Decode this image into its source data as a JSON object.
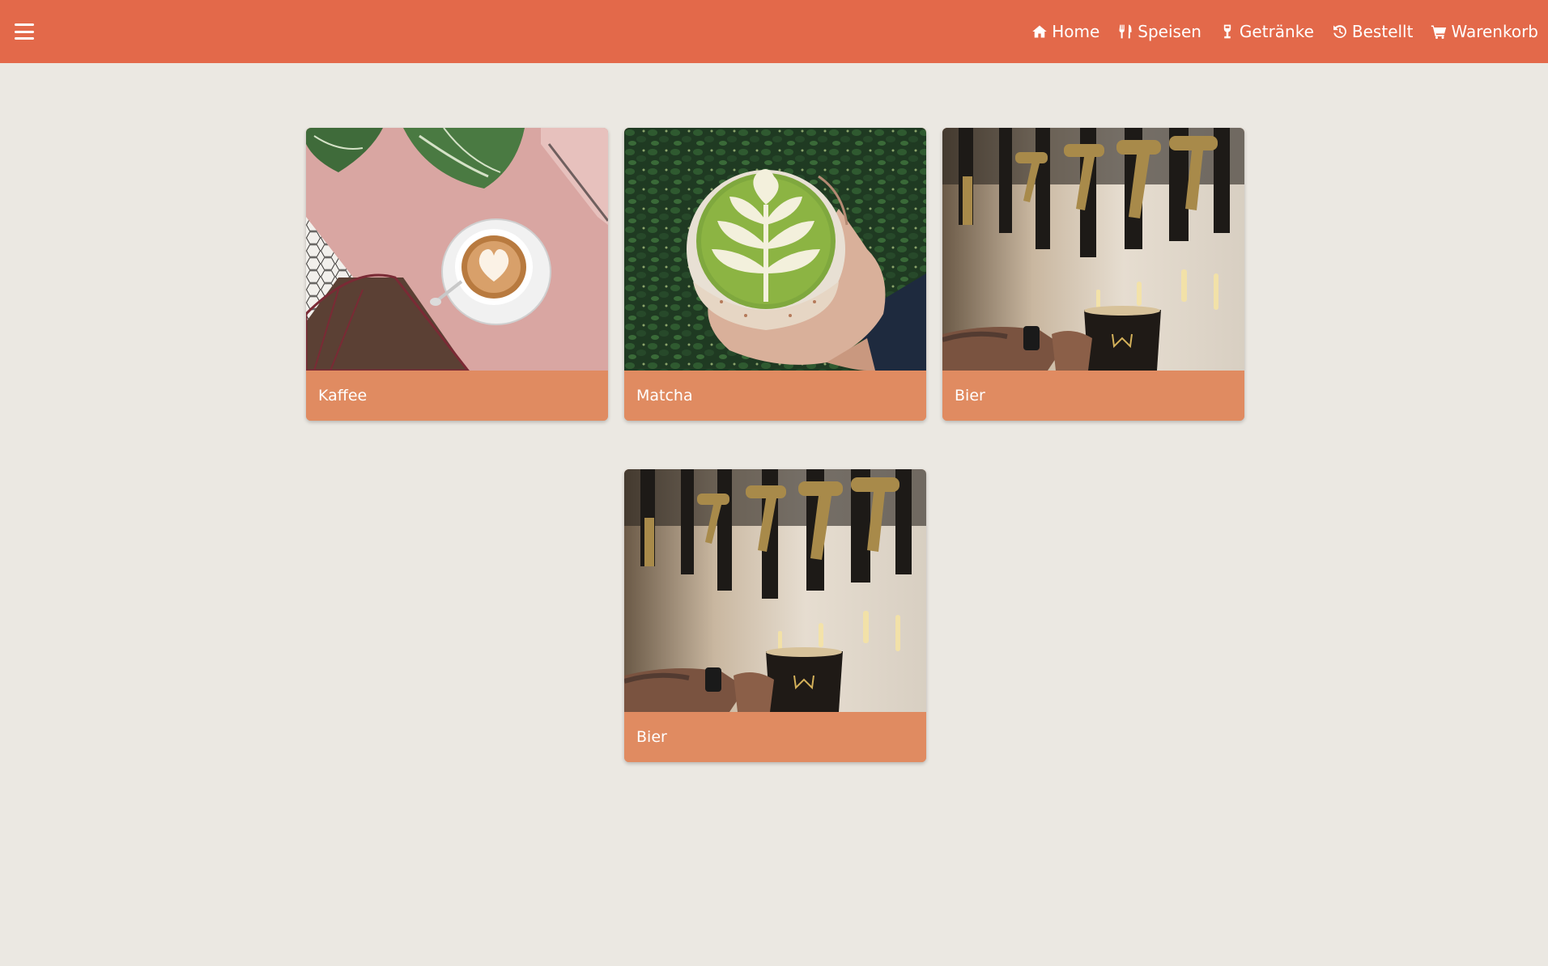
{
  "header": {
    "menu_icon": "hamburger-icon",
    "accent_color": "#e3694a",
    "nav": [
      {
        "label": "Home",
        "icon": "home-icon"
      },
      {
        "label": "Speisen",
        "icon": "utensils-icon"
      },
      {
        "label": "Getränke",
        "icon": "drink-icon"
      },
      {
        "label": "Bestellt",
        "icon": "history-icon"
      },
      {
        "label": "Warenkorb",
        "icon": "cart-icon"
      }
    ]
  },
  "categories": [
    {
      "title": "Kaffee",
      "image": "latte-art-coffee-photo"
    },
    {
      "title": "Matcha",
      "image": "matcha-latte-photo"
    },
    {
      "title": "Bier",
      "image": "beer-taps-photo"
    },
    {
      "title": "Bier",
      "image": "beer-taps-photo"
    }
  ],
  "colors": {
    "background": "#ebe8e2",
    "card_footer": "#e08b61"
  }
}
